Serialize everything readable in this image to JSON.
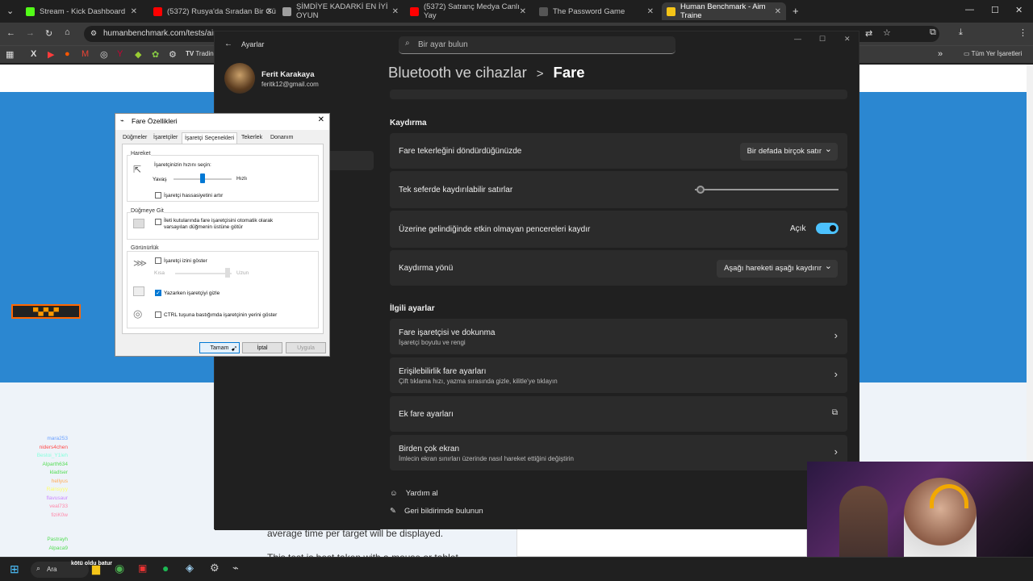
{
  "browser": {
    "tabs": [
      {
        "title": "Stream - Kick Dashboard",
        "color": "#53fc18"
      },
      {
        "title": "(5372) Rusya'da Sıradan Bir Gü",
        "color": "#ff0000"
      },
      {
        "title": "ŞİMDİYE KADARKİ EN İYİ OYUN",
        "color": "#ff0000"
      },
      {
        "title": "(5372) Satranç Medya Canlı Yay",
        "color": "#ff0000"
      },
      {
        "title": "The Password Game",
        "color": "#444444"
      },
      {
        "title": "Human Benchmark - Aim Traine",
        "color": "#f5c518"
      }
    ],
    "url": "humanbenchmark.com/tests/aim",
    "bookmark_partial": "Tradin",
    "all_bookmarks": "Tüm Yer İşaretleri"
  },
  "settings": {
    "window_title": "Ayarlar",
    "search_placeholder": "Bir ayar bulun",
    "user_name": "Ferit Karakaya",
    "user_email": "feritk12@gmail.com",
    "breadcrumb_parent": "Bluetooth ve cihazlar",
    "breadcrumb_sep": ">",
    "breadcrumb_current": "Fare",
    "section_scrolling": "Kaydırma",
    "row_wheel_label": "Fare tekerleğini döndürdüğünüzde",
    "row_wheel_value": "Bir defada birçok satır",
    "row_lines_label": "Tek seferde kaydırılabilir satırlar",
    "row_lines_fraction": 0.04,
    "row_inactive_label": "Üzerine gelindiğinde etkin olmayan pencereleri kaydır",
    "row_inactive_state": "Açık",
    "row_direction_label": "Kaydırma yönü",
    "row_direction_value": "Aşağı hareketi aşağı kaydırır",
    "section_related": "İlgili ayarlar",
    "related": [
      {
        "title": "Fare işaretçisi ve dokunma",
        "sub": "İşaretçi boyutu ve rengi"
      },
      {
        "title": "Erişilebilirlik fare ayarları",
        "sub": "Çift tıklama hızı, yazma sırasında gizle, kilitle'ye tıklayın"
      },
      {
        "title": "Ek fare ayarları",
        "sub": ""
      },
      {
        "title": "Birden çok ekran",
        "sub": "İmlecin ekran sınırları üzerinde nasıl hareket ettiğini değiştirin"
      }
    ],
    "help": "Yardım al",
    "feedback": "Geri bildirimde bulunun"
  },
  "dialog": {
    "title": "Fare Özellikleri",
    "tabs": [
      "Düğmeler",
      "İşaretçiler",
      "İşaretçi Seçenekleri",
      "Tekerlek",
      "Donanım"
    ],
    "group_motion": "Hareket",
    "speed_label": "İşaretçinizin hızını seçin:",
    "slow": "Yavaş",
    "fast": "Hızlı",
    "speed_fraction": 0.5,
    "precision": "İşaretçi hassasiyetini artır",
    "group_snap": "Düğmeye Git",
    "snap_text": "İleti kutularında fare işaretçisini otomatik olarak varsayılan düğmenin üstüne götür",
    "group_visibility": "Görünürlük",
    "trails": "İşaretçi izini göster",
    "short": "Kısa",
    "long": "Uzun",
    "hide_typing": "Yazarken işaretçiyi gizle",
    "ctrl_show": "CTRL tuşuna bastığımda işaretçinin yerini göster",
    "ok": "Tamam",
    "cancel": "İptal",
    "apply": "Uygula"
  },
  "chat": {
    "names": [
      "mara253",
      "niders4chen",
      "Bestoi_Y1leh",
      "Alparth634",
      "kladlser",
      "hellyus",
      "Rainsyyy",
      "flavusaur",
      "veal733",
      "fiziK0w",
      "Pastrayh",
      "Alpaca9"
    ]
  },
  "page": {
    "text1": "average time per target will be displayed.",
    "text2": "This test is best taken with a mouse or tablet"
  },
  "taskbar": {
    "search": "Ara",
    "search_hint": "kötü oldu batur"
  },
  "colors": {
    "accent": "#2b87d1",
    "toggle": "#4cc2ff"
  }
}
